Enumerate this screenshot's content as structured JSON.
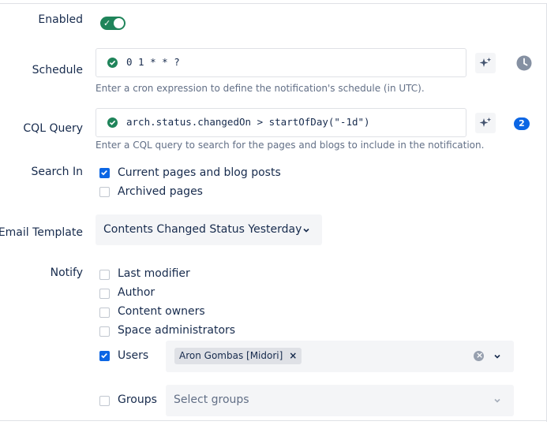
{
  "labels": {
    "enabled": "Enabled",
    "schedule": "Schedule",
    "cql_query": "CQL Query",
    "search_in": "Search In",
    "email_template": "Email Template",
    "notify": "Notify"
  },
  "enabled": {
    "on": true
  },
  "schedule": {
    "value": "0 1 * * ?",
    "help": "Enter a cron expression to define the notification's schedule (in UTC)."
  },
  "cql": {
    "value": "arch.status.changedOn > startOfDay(\"-1d\")",
    "help": "Enter a CQL query to search for the pages and blogs to include in the notification.",
    "badge": "2"
  },
  "search_in": {
    "options": [
      {
        "label": "Current pages and blog posts",
        "checked": true
      },
      {
        "label": "Archived pages",
        "checked": false
      }
    ]
  },
  "email_template": {
    "selected": "Contents Changed Status Yesterday"
  },
  "notify": {
    "options": [
      {
        "label": "Last modifier",
        "checked": false
      },
      {
        "label": "Author",
        "checked": false
      },
      {
        "label": "Content owners",
        "checked": false
      },
      {
        "label": "Space administrators",
        "checked": false
      }
    ],
    "users": {
      "label": "Users",
      "checked": true,
      "selected_tag": "Aron Gombas [Midori]"
    },
    "groups": {
      "label": "Groups",
      "checked": false,
      "placeholder": "Select groups"
    }
  },
  "icons": {
    "valid": "check-circle-icon",
    "magic": "sparkle-icon",
    "history": "clock-icon",
    "dropdown": "chevron-down-icon",
    "clear": "clear-icon",
    "remove": "close-icon"
  },
  "colors": {
    "success": "#1f845a",
    "primary": "#0c66e4",
    "field_bg": "#f4f5f7",
    "muted_text": "#626f86"
  }
}
